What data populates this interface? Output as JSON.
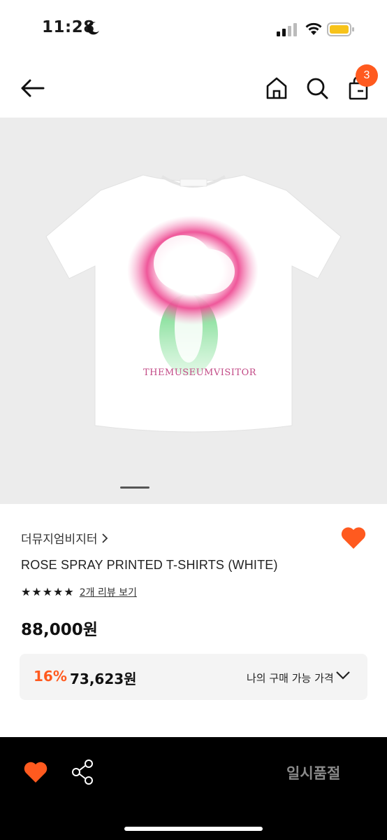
{
  "status": {
    "time": "11:28",
    "battery_color": "#f7c31a"
  },
  "header": {
    "cart_count": "3"
  },
  "product": {
    "print_text": "THEMUSEUMVISITOR",
    "brand": "더뮤지엄비지터",
    "name": "ROSE SPRAY PRINTED T-SHIRTS (WHITE)",
    "rating_stars": 5,
    "review_link": "2개 리뷰 보기",
    "price": "88,000원",
    "discount_percent": "16%",
    "discount_price": "73,623원",
    "my_price_label": "나의 구매 가능 가격",
    "carousel_index": 1
  },
  "bottom": {
    "soldout_label": "일시품절"
  },
  "colors": {
    "accent": "#ff5a1f",
    "background_image": "#ececec",
    "bottom_bar": "#000000"
  }
}
